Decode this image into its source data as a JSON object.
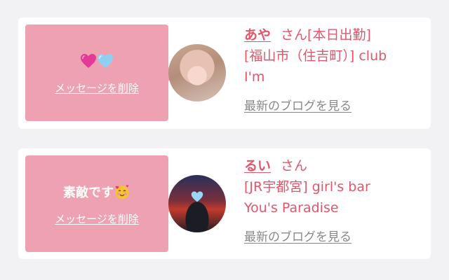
{
  "cards": [
    {
      "bubble": {
        "message": "",
        "delete_label": "メッセージを削除",
        "emoji_icons": [
          "pink-heart-icon",
          "light-blue-heart-icon"
        ]
      },
      "avatar": "avatar-photo",
      "name": "あや",
      "honorific": "さん",
      "status": "[本日出勤]",
      "shop_line1": "[福山市（住吉町）] club",
      "shop_line2": "I'm",
      "blog_label": "最新のブログを見る"
    },
    {
      "bubble": {
        "message": "素敵です",
        "delete_label": "メッセージを削除",
        "emoji_icons": [
          "smiling-face-with-hearts-icon"
        ]
      },
      "avatar": "avatar-photo",
      "name": "るい",
      "honorific": "さん",
      "status": "",
      "shop_line1": "[JR宇都宮] girl's bar",
      "shop_line2": "You's Paradise",
      "blog_label": "最新のブログを見る"
    }
  ],
  "colors": {
    "bubble": "#eea1b1",
    "accent_text": "#e0566b",
    "link_gray": "#888888",
    "card": "#ffffff",
    "background": "#f2f2f4"
  }
}
